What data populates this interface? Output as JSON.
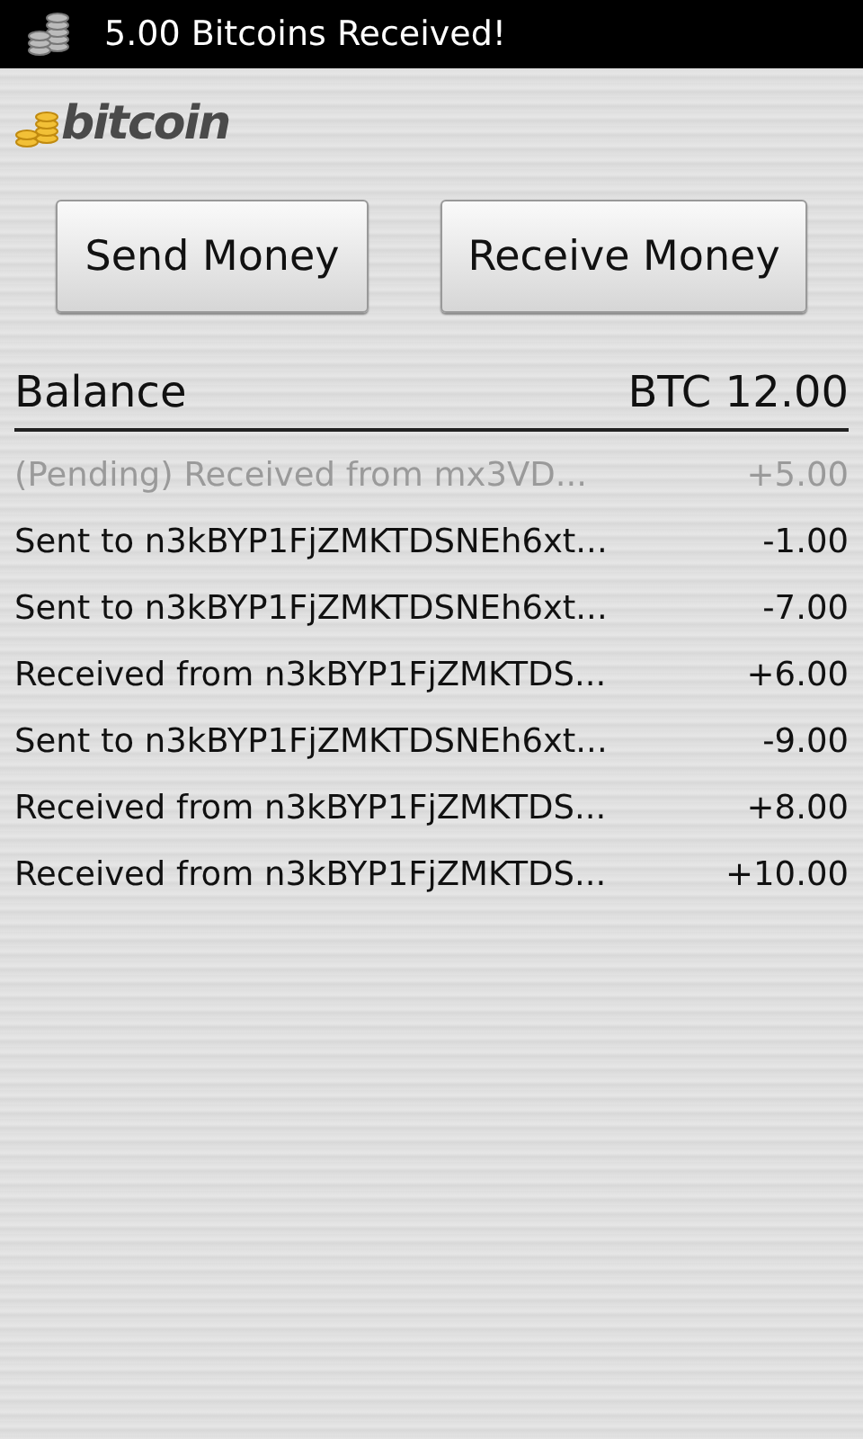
{
  "status_bar": {
    "notification": "5.00 Bitcoins Received!"
  },
  "logo": {
    "text": "bitcoin"
  },
  "buttons": [
    {
      "label": "Send Money"
    },
    {
      "label": "Receive Money"
    }
  ],
  "balance": {
    "label": "Balance",
    "value": "BTC 12.00"
  },
  "transactions": [
    {
      "description": "(Pending) Received from mx3VD...",
      "amount": "+5.00",
      "pending": true
    },
    {
      "description": "Sent to n3kBYP1FjZMKTDSNEh6xt...",
      "amount": "-1.00",
      "pending": false
    },
    {
      "description": "Sent to n3kBYP1FjZMKTDSNEh6xt...",
      "amount": "-7.00",
      "pending": false
    },
    {
      "description": "Received from n3kBYP1FjZMKTDS...",
      "amount": "+6.00",
      "pending": false
    },
    {
      "description": "Sent to n3kBYP1FjZMKTDSNEh6xt...",
      "amount": "-9.00",
      "pending": false
    },
    {
      "description": "Received from n3kBYP1FjZMKTDS...",
      "amount": "+8.00",
      "pending": false
    },
    {
      "description": "Received from n3kBYP1FjZMKTDS...",
      "amount": "+10.00",
      "pending": false
    }
  ]
}
